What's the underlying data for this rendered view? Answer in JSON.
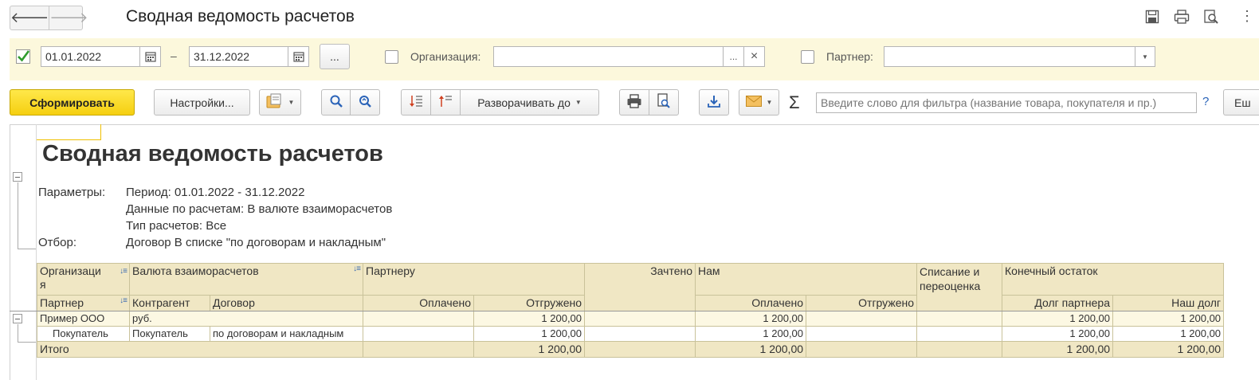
{
  "window": {
    "title": "Сводная ведомость расчетов"
  },
  "filters": {
    "period_from": "01.01.2022",
    "dash": "–",
    "period_to": "31.12.2022",
    "more_label": "...",
    "org_label": "Организация:",
    "org_value": "",
    "org_select": "...",
    "org_clear": "×",
    "partner_label": "Партнер:",
    "partner_value": ""
  },
  "toolbar": {
    "generate_label": "Сформировать",
    "settings_label": "Настройки...",
    "expand_label": "Разворачивать до",
    "filter_placeholder": "Введите слово для фильтра (название товара, покупателя и пр.)",
    "help_label": "?",
    "more_label": "Еш",
    "sigma": "Σ"
  },
  "report": {
    "title": "Сводная ведомость расчетов",
    "params_label": "Параметры:",
    "param_period": "Период: 01.01.2022 - 31.12.2022",
    "param_data": "Данные по расчетам: В валюте взаиморасчетов",
    "param_type": "Тип расчетов: Все",
    "filter_label": "Отбор:",
    "filter_value": "Договор В списке \"по договорам и накладным\"",
    "headers": {
      "org_a": "Организаци",
      "org_b": "я",
      "currency": "Валюта взаиморасчетов",
      "to_partner": "Партнеру",
      "offset": "Зачтено",
      "to_us": "Нам",
      "writeoff_a": "Списание и",
      "writeoff_b": "переоценка",
      "final_balance": "Конечный остаток",
      "partner": "Партнер",
      "counterparty": "Контрагент",
      "contract": "Договор",
      "paid": "Оплачено",
      "shipped": "Отгружено",
      "paid2": "Оплачено",
      "shipped2": "Отгружено",
      "partner_debt": "Долг партнера",
      "our_debt": "Наш долг"
    },
    "rows": [
      {
        "org": "Пример ООО",
        "cur": "руб.",
        "contract": "",
        "paid": "",
        "shipped": "1 200,00",
        "offset": "",
        "paid2": "1 200,00",
        "shipped2": "",
        "writeoff": "",
        "partner_debt": "1 200,00",
        "our_debt": "1 200,00"
      },
      {
        "org": "Покупатель",
        "cur": "Покупатель",
        "contract": "по договорам и накладным",
        "paid": "",
        "shipped": "1 200,00",
        "offset": "",
        "paid2": "1 200,00",
        "shipped2": "",
        "writeoff": "",
        "partner_debt": "1 200,00",
        "our_debt": "1 200,00"
      }
    ],
    "total": {
      "label": "Итого",
      "shipped": "1 200,00",
      "paid2": "1 200,00",
      "partner_debt": "1 200,00",
      "our_debt": "1 200,00"
    }
  },
  "colors": {
    "accent_yellow": "#f5cf10",
    "filter_bg": "#fcf8dc",
    "header_bg": "#f0e7c4",
    "check_green": "#2e9b2e",
    "icon_blue": "#2a63b8"
  }
}
